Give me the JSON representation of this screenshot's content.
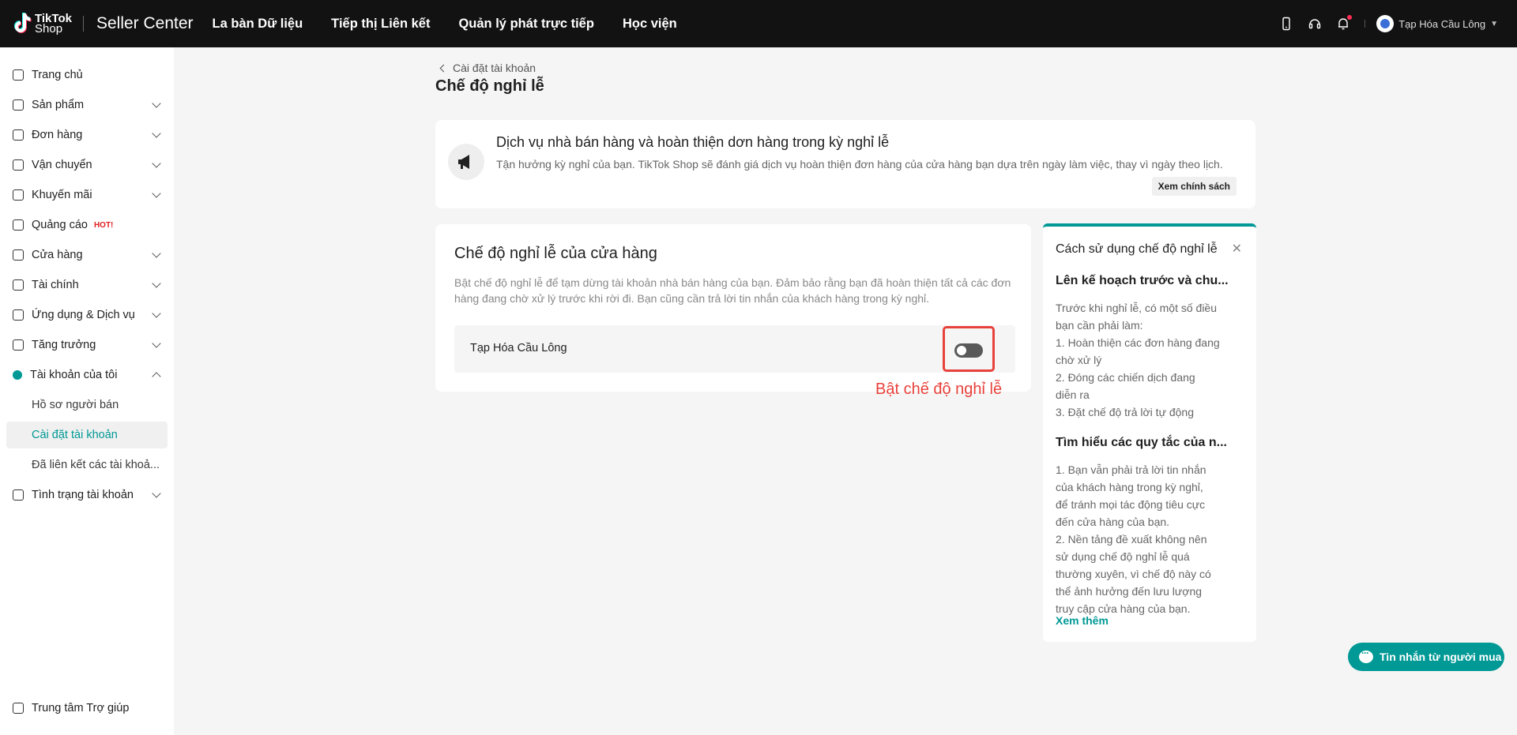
{
  "header": {
    "logo_line1": "TikTok",
    "logo_line2": "Shop",
    "product": "Seller Center",
    "nav": [
      "La bàn Dữ liệu",
      "Tiếp thị Liên kết",
      "Quản lý phát trực tiếp",
      "Học viện"
    ],
    "shop_name": "Tạp Hóa Cầu Lông"
  },
  "sidebar": {
    "items": [
      {
        "label": "Trang chủ",
        "icon": "home-icon"
      },
      {
        "label": "Sản phẩm",
        "icon": "product-icon"
      },
      {
        "label": "Đơn hàng",
        "icon": "order-icon"
      },
      {
        "label": "Vận chuyển",
        "icon": "shipping-icon"
      },
      {
        "label": "Khuyến mãi",
        "icon": "megaphone-icon"
      },
      {
        "label": "Quảng cáo",
        "icon": "ads-icon",
        "badge": "HOT!"
      },
      {
        "label": "Cửa hàng",
        "icon": "store-icon"
      },
      {
        "label": "Tài chính",
        "icon": "finance-icon"
      },
      {
        "label": "Ứng dụng & Dịch vụ",
        "icon": "apps-icon"
      },
      {
        "label": "Tăng trưởng",
        "icon": "growth-icon"
      },
      {
        "label": "Tài khoản của tôi",
        "icon": "account-icon"
      },
      {
        "label": "Hồ sơ người bán"
      },
      {
        "label": "Cài đặt tài khoản"
      },
      {
        "label": "Đã liên kết các tài khoả..."
      },
      {
        "label": "Tình trạng tài khoản",
        "icon": "trophy-icon"
      }
    ],
    "help": "Trung tâm Trợ giúp"
  },
  "page": {
    "breadcrumb": "Cài đặt tài khoản",
    "title": "Chế độ nghỉ lễ"
  },
  "banner": {
    "title": "Dịch vụ nhà bán hàng và hoàn thiện dơn hàng trong kỳ nghỉ lễ",
    "desc": "Tận hưởng kỳ nghỉ của bạn. TikTok Shop sẽ đánh giá dịch vụ hoàn thiện đơn hàng của cửa hàng bạn dựa trên ngày làm việc, thay vì ngày theo lịch.",
    "policy_label": "Xem chính sách"
  },
  "vacation_card": {
    "title": "Chế độ nghỉ lễ của cửa hàng",
    "desc": "Bật chế độ nghỉ lễ để tạm dừng tài khoản nhà bán hàng của bạn. Đảm bảo rằng bạn đã hoàn thiện tất cả các đơn hàng đang chờ xử lý trước khi rời đi. Bạn cũng cần trả lời tin nhắn của khách hàng trong kỳ nghỉ.",
    "shop_name": "Tạp Hóa Cầu Lông",
    "toggle_on": false,
    "annotation": "Bật chế độ nghỉ lễ"
  },
  "guide": {
    "title": "Cách sử dụng chế độ nghỉ lễ",
    "heading1": "Lên kế hoạch trước và chu...",
    "lines1": [
      "Trước khi nghỉ lễ, có một số điều",
      "bạn cần phải làm:",
      "1. Hoàn thiện các đơn hàng đang",
      "chờ xử lý",
      "2. Đóng các chiến dịch đang",
      "diễn ra",
      "3. Đặt chế độ trả lời tự động"
    ],
    "heading2": "Tìm hiểu các quy tắc của n...",
    "lines2": [
      "1. Bạn vẫn phải trả lời tin nhắn",
      "của khách hàng trong kỳ nghỉ,",
      "để tránh mọi tác động tiêu cực",
      "đến cửa hàng của bạn.",
      "2. Nền tảng đề xuất không nên",
      "sử dụng chế độ nghỉ lễ quá",
      "thường xuyên, vì chế độ này có",
      "thể ảnh hưởng đến lưu lượng",
      "truy cập cửa hàng của bạn."
    ],
    "more": "Xem thêm"
  },
  "chat": {
    "label": "Tin nhắn từ người mua"
  },
  "colors": {
    "accent": "#009995",
    "highlight": "#e8413b",
    "topbar": "#121212"
  }
}
